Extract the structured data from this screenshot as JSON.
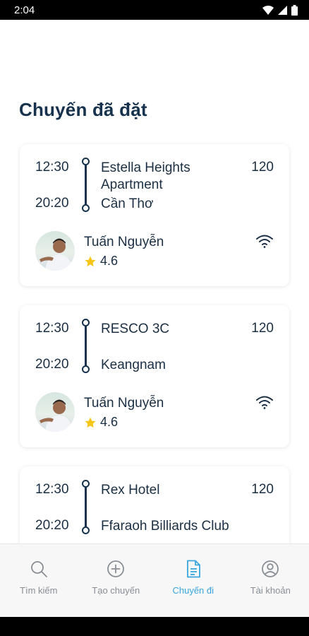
{
  "status_bar": {
    "time": "2:04"
  },
  "page": {
    "title": "Chuyến đã đặt"
  },
  "trips": [
    {
      "depart_time": "12:30",
      "arrive_time": "20:20",
      "from": "Estella Heights Apartment",
      "to": "Cần Thơ",
      "price": "120",
      "driver": {
        "name": "Tuấn Nguyễn",
        "rating": "4.6"
      }
    },
    {
      "depart_time": "12:30",
      "arrive_time": "20:20",
      "from": "RESCO 3C",
      "to": "Keangnam",
      "price": "120",
      "driver": {
        "name": "Tuấn Nguyễn",
        "rating": "4.6"
      }
    },
    {
      "depart_time": "12:30",
      "arrive_time": "20:20",
      "from": "Rex Hotel",
      "to": "Ffaraoh Billiards Club",
      "price": "120"
    }
  ],
  "nav": {
    "items": [
      {
        "label": "Tìm kiếm",
        "icon": "search-icon",
        "active": false
      },
      {
        "label": "Tạo chuyến",
        "icon": "plus-circle-icon",
        "active": false
      },
      {
        "label": "Chuyến đi",
        "icon": "document-icon",
        "active": true
      },
      {
        "label": "Tài khoản",
        "icon": "account-icon",
        "active": false
      }
    ]
  },
  "colors": {
    "primary": "#17324d",
    "accent": "#3aa6dd",
    "star": "#f5c518",
    "inactive": "#8a8f96"
  }
}
